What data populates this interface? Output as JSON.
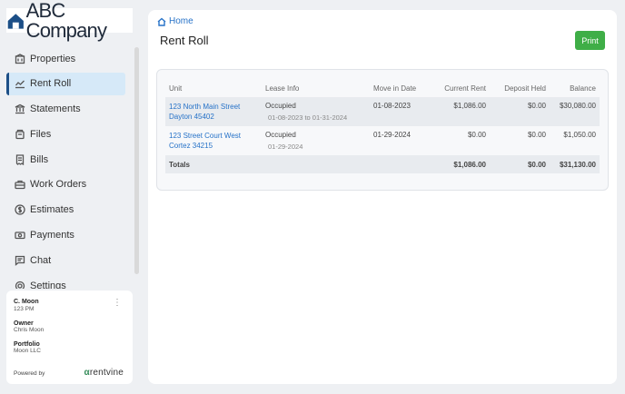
{
  "brand": {
    "name": "ABC Company",
    "accent": "#1c4f87"
  },
  "sidebar": {
    "items": [
      {
        "label": "Properties",
        "icon": "building-icon"
      },
      {
        "label": "Rent Roll",
        "icon": "chart-icon",
        "active": true
      },
      {
        "label": "Statements",
        "icon": "bank-icon"
      },
      {
        "label": "Files",
        "icon": "folder-icon"
      },
      {
        "label": "Bills",
        "icon": "receipt-icon"
      },
      {
        "label": "Work Orders",
        "icon": "toolbox-icon"
      },
      {
        "label": "Estimates",
        "icon": "dollar-circle-icon"
      },
      {
        "label": "Payments",
        "icon": "money-icon"
      },
      {
        "label": "Chat",
        "icon": "chat-icon"
      },
      {
        "label": "Settings",
        "icon": "gear-icon"
      }
    ]
  },
  "profile": {
    "name": "C. Moon",
    "time": "123 PM",
    "owner_label": "Owner",
    "owner_value": "Chris Moon",
    "portfolio_label": "Portfolio",
    "portfolio_value": "Moon LLC",
    "powered_by": "Powered by",
    "vendor": "rentvine"
  },
  "main": {
    "breadcrumb": "Home",
    "title": "Rent Roll",
    "print_label": "Print",
    "print_color": "#3fae47",
    "link_color": "#2672c8"
  },
  "table": {
    "headers": [
      "Unit",
      "Lease Info",
      "Move in Date",
      "Current Rent",
      "Deposit Held",
      "Balance"
    ],
    "rows": [
      {
        "unit_line1": "123 North Main Street",
        "unit_line2": "Dayton 45402",
        "lease_status": "Occupied",
        "lease_dates": "01-08-2023 to 01-31-2024",
        "move_in": "01-08-2023",
        "current_rent": "$1,086.00",
        "deposit": "$0.00",
        "balance": "$30,080.00"
      },
      {
        "unit_line1": "123 Street Court West",
        "unit_line2": "Cortez 34215",
        "lease_status": "Occupied",
        "lease_dates": "01-29-2024",
        "move_in": "01-29-2024",
        "current_rent": "$0.00",
        "deposit": "$0.00",
        "balance": "$1,050.00"
      }
    ],
    "totals": {
      "label": "Totals",
      "current_rent": "$1,086.00",
      "deposit": "$0.00",
      "balance": "$31,130.00"
    }
  }
}
